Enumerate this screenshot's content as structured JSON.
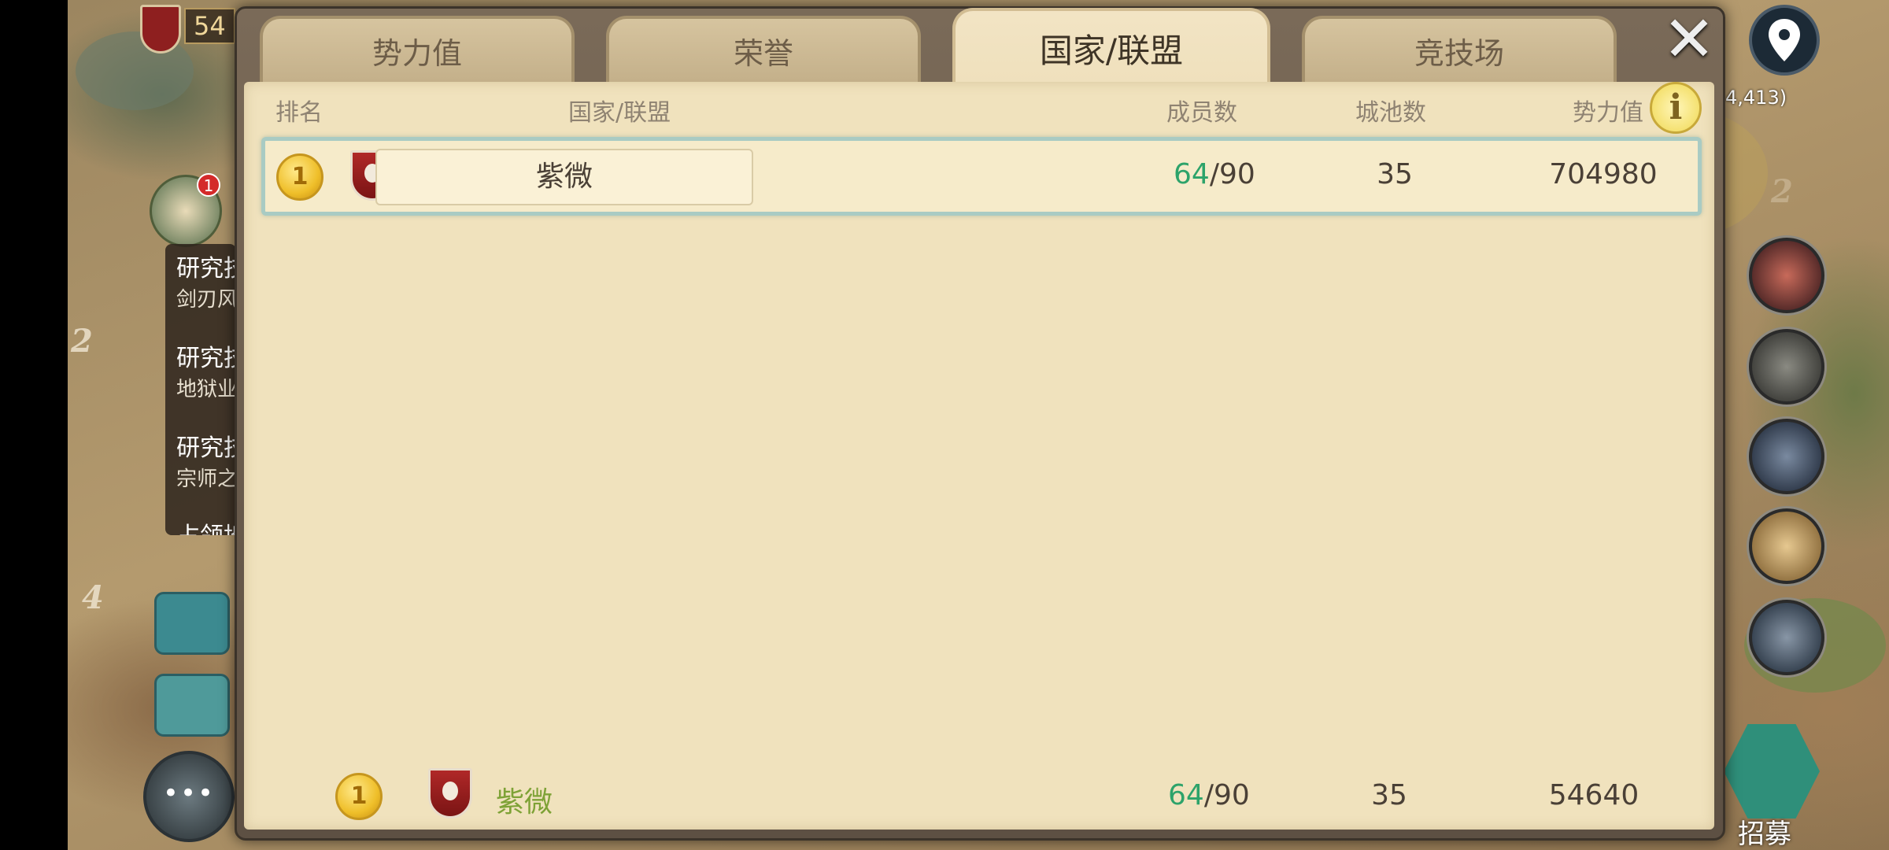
{
  "hud": {
    "power_count": "54"
  },
  "quests": [
    {
      "title": "研究技",
      "sub": "剑刃风"
    },
    {
      "title": "研究技",
      "sub": "地狱业"
    },
    {
      "title": "研究技",
      "sub": "宗师之"
    },
    {
      "title": "占领地",
      "sub": ""
    }
  ],
  "quest_badge": "1",
  "map": {
    "coords": "4,413)",
    "numbers": [
      "2",
      "4",
      "2"
    ]
  },
  "recruit_label": "招募",
  "tabs": [
    {
      "label": "势力值",
      "active": false
    },
    {
      "label": "荣誉",
      "active": false
    },
    {
      "label": "国家/联盟",
      "active": true
    },
    {
      "label": "竞技场",
      "active": false
    }
  ],
  "close_label": "✕",
  "info_label": "i",
  "columns": {
    "rank": "排名",
    "nation": "国家/联盟",
    "members": "成员数",
    "cities": "城池数",
    "power": "势力值"
  },
  "rows": [
    {
      "rank": "1",
      "name": "紫微",
      "members_current": "64",
      "members_sep": "/90",
      "cities": "35",
      "power": "704980"
    }
  ],
  "my_entry": {
    "rank": "1",
    "name": "紫微",
    "members_current": "64",
    "members_sep": "/90",
    "cities": "35",
    "power": "54640"
  },
  "colors": {
    "members_current": "#2da36a",
    "my_name": "#7ea236",
    "panel_bg": "#f0e2bd",
    "row_border": "#a9cbc3"
  }
}
